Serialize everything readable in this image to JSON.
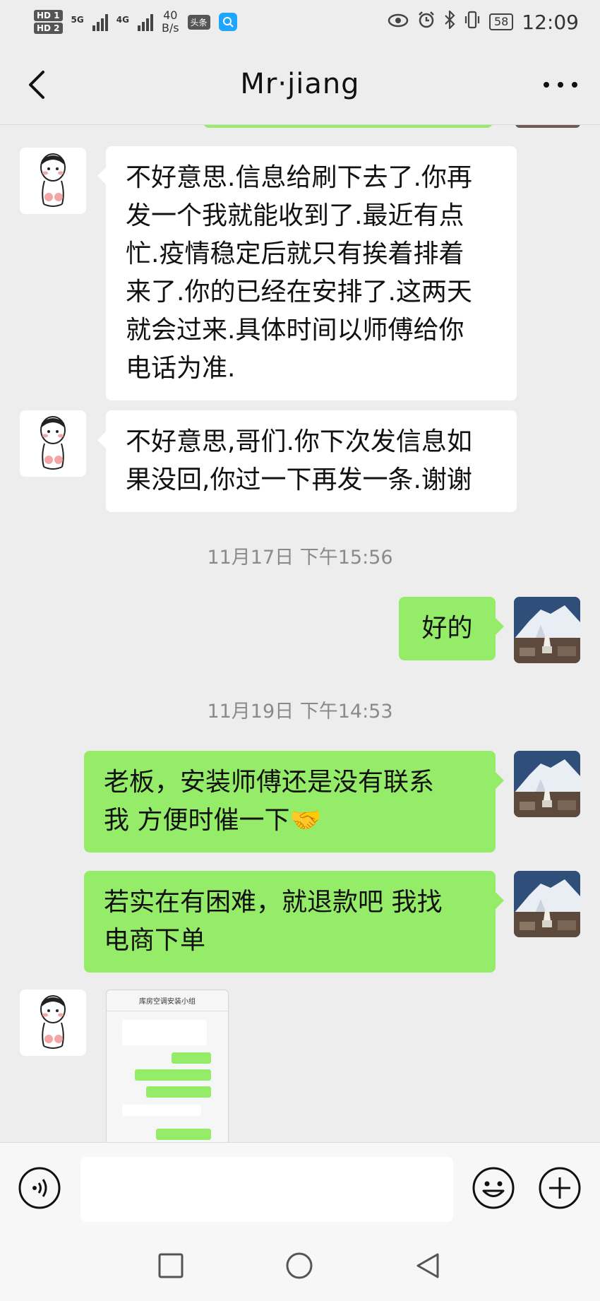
{
  "status_bar": {
    "hd1": "HD 1",
    "hd2": "HD 2",
    "net_5g": "5G",
    "net_4g": "4G",
    "speed_value": "40",
    "speed_unit": "B/s",
    "toutiao_badge": "头条",
    "battery": "58",
    "time": "12:09"
  },
  "header": {
    "title": "Mr·jiang"
  },
  "messages": [
    {
      "direction": "incoming",
      "lines": [
        "不好意思.信息给刷下去了.你再",
        "发一个我就能收到了.最近有点",
        "忙.疫情稳定后就只有挨着排着",
        "来了.你的已经在安排了.这两天",
        "就会过来.具体时间以师傅给你",
        "电话为准."
      ]
    },
    {
      "direction": "incoming",
      "lines": [
        "不好意思,哥们.你下次发信息如",
        "果没回,你过一下再发一条.谢谢"
      ]
    },
    {
      "timestamp": "11月17日 下午15:56"
    },
    {
      "direction": "outgoing",
      "lines": [
        "好的"
      ]
    },
    {
      "timestamp": "11月19日 下午14:53"
    },
    {
      "direction": "outgoing",
      "lines": [
        "老板，安装师傅还是没有联系",
        "我  方便时催一下🤝"
      ]
    },
    {
      "direction": "outgoing",
      "lines": [
        "若实在有困难，就退款吧  我找",
        "电商下单"
      ]
    },
    {
      "direction": "incoming",
      "type": "image",
      "image_title": "库房空调安装小组"
    }
  ],
  "colors": {
    "background": "#ededed",
    "bubble_out": "#95ec69",
    "bubble_in": "#ffffff",
    "timestamp": "#8a8a8a"
  },
  "icons": {
    "back": "chevron-left-icon",
    "more": "more-dots-icon",
    "voice": "voice-icon",
    "emoji": "emoji-icon",
    "plus": "plus-icon",
    "recents": "square-icon",
    "home": "circle-icon",
    "nav_back": "triangle-back-icon"
  }
}
